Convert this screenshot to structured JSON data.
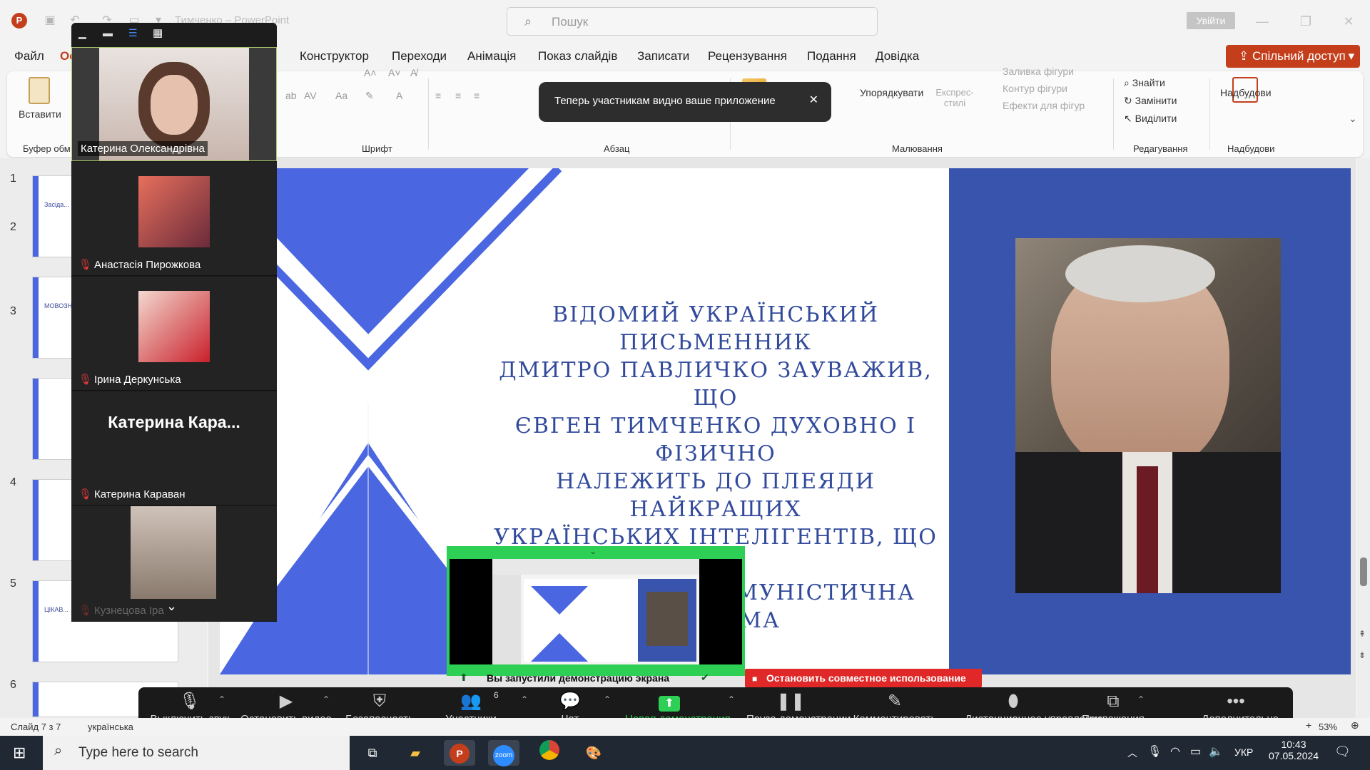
{
  "titlebar": {
    "doc_title": "Тимченко – PowerPoint",
    "search_placeholder": "Пошук",
    "signin_label": "Увійти"
  },
  "menu": {
    "tabs": [
      "Файл",
      "Ос",
      "Конструктор",
      "Переходи",
      "Анімація",
      "Показ слайдів",
      "Записати",
      "Рецензування",
      "Подання",
      "Довідка"
    ],
    "share_label": "Спільний доступ"
  },
  "ribbon": {
    "paste_label": "Вставити",
    "clipboard_group": "Буфер обм",
    "font_group": "Шрифт",
    "paragraph_group": "Абзац",
    "arrange_label": "Упорядкувати",
    "quick_styles_label": "Експрес-стилі",
    "shape_fill": "Заливка фігури",
    "shape_outline": "Контур фігури",
    "shape_effects": "Ефекти для фігур",
    "drawing_group": "Малювання",
    "find_label": "Знайти",
    "replace_label": "Замінити",
    "select_label": "Виділити",
    "editing_group": "Редагування",
    "addins_label": "Надбудови",
    "addins_group": "Надбудови"
  },
  "slides": {
    "numbers": [
      "1",
      "2",
      "3",
      "4",
      "5",
      "6"
    ],
    "thumbs": [
      "Засіда...",
      "МОВОЗН... ЄВГЕ...",
      "",
      "",
      "ЦІКАВ...",
      ""
    ]
  },
  "slide": {
    "lines": [
      "ВІДОМИЙ УКРАЇНСЬКИЙ ПИСЬМЕННИК",
      "ДМИТРО ПАВЛИЧКО ЗАУВАЖИВ, ЩО",
      "ЄВГЕН ТИМЧЕНКО ДУХОВНО І ФІЗИЧНО",
      "НАЛЕЖИТЬ ДО ПЛЕЯДИ НАЙКРАЩИХ",
      "УКРАЇНСЬКИХ ІНТЕЛІГЕНТІВ, ЩО ЇХ",
      "РОЗТОПТАЛА КОМУНІСТИЧНА СИСТЕМА"
    ]
  },
  "zoom": {
    "participants": [
      {
        "name": "Катерина Олександрівна",
        "muted": false
      },
      {
        "name": "Анастасія Пирожкова",
        "muted": true
      },
      {
        "name": "Ірина Деркунська",
        "muted": true
      },
      {
        "name": "Катерина Караван",
        "muted": true,
        "big_name": "Катерина  Кара..."
      },
      {
        "name": "Кузнецова Іра",
        "muted": true
      }
    ],
    "toast": "Теперь участникам видно ваше приложение",
    "share_status": "Вы запустили демонстрацию экрана",
    "stop_share": "Остановить совместное использование",
    "bar": {
      "mute": "Выключить звук",
      "video": "Остановить видео",
      "security": "Безопасность",
      "participants": "Участники",
      "participants_count": "6",
      "chat": "Чат",
      "new_share": "Новая демонстрация",
      "pause_share": "Пауза демонстрации",
      "annotate": "Комментировать",
      "remote": "Дистанционное управление",
      "apps": "Приложения",
      "more": "Дополнительно"
    }
  },
  "statusbar": {
    "slide_info": "Слайд 7 з 7",
    "language": "українська",
    "zoom": "53%"
  },
  "taskbar": {
    "search_placeholder": "Type here to search",
    "lang": "УКР",
    "time": "10:43",
    "date": "07.05.2024"
  },
  "colors": {
    "accent": "#c43e1c",
    "slide_blue": "#4a66e0",
    "slide_dark_blue": "#3954ad",
    "zoom_green": "#2dcf54",
    "stop_red": "#e02828"
  }
}
